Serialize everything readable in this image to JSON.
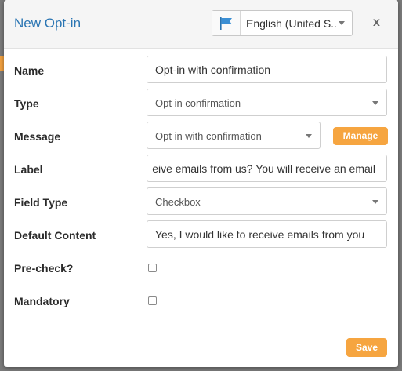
{
  "dialog": {
    "title": "New Opt-in",
    "close_label": "x",
    "language": {
      "selected": "English (United S..."
    }
  },
  "form": {
    "name": {
      "label": "Name",
      "value": "Opt-in with confirmation"
    },
    "type": {
      "label": "Type",
      "value": "Opt in confirmation"
    },
    "message": {
      "label": "Message",
      "value": "Opt in with confirmation",
      "manage_label": "Manage"
    },
    "field_label": {
      "label": "Label",
      "value": "eive emails from us? You will receive an email"
    },
    "field_type": {
      "label": "Field Type",
      "value": "Checkbox"
    },
    "default_content": {
      "label": "Default Content",
      "value": "Yes, I would like to receive emails from you"
    },
    "precheck": {
      "label": "Pre-check?",
      "checked": false
    },
    "mandatory": {
      "label": "Mandatory",
      "checked": false
    }
  },
  "footer": {
    "save_label": "Save"
  },
  "colors": {
    "accent": "#f6a540",
    "title": "#2a75b3"
  }
}
